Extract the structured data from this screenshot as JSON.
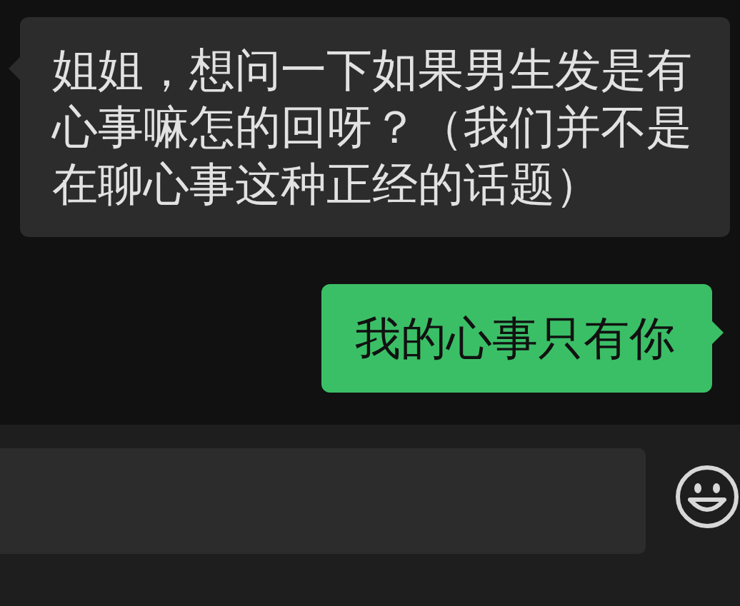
{
  "messages": [
    {
      "kind": "incoming",
      "text": "姐姐，想问一下如果男生发是有心事嘛怎的回呀？（我们并不是在聊心事这种正经的话题）"
    },
    {
      "kind": "outgoing",
      "text": "我的心事只有你"
    }
  ]
}
